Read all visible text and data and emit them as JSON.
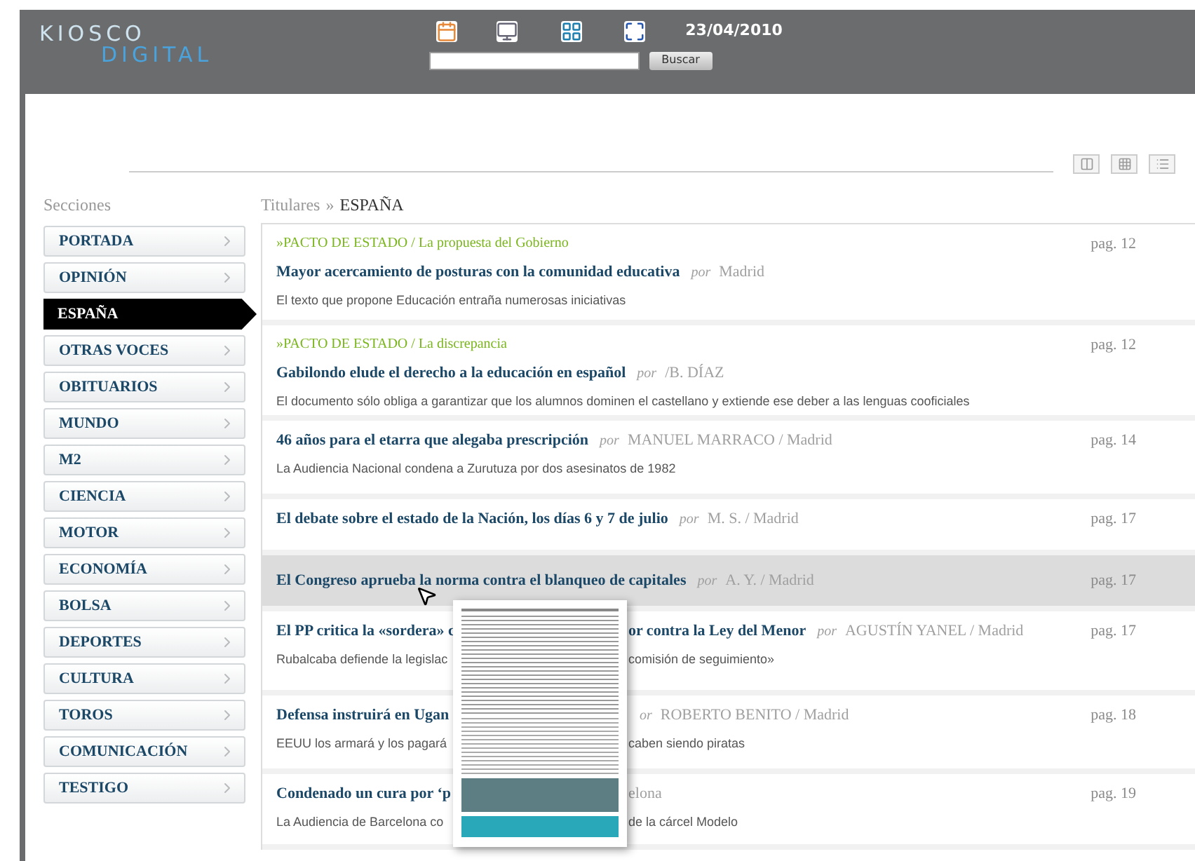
{
  "header": {
    "logo_top": "KIOSCO",
    "logo_bottom": "DIGITAL",
    "date": "23/04/2010",
    "search_button": "Buscar"
  },
  "sidebar": {
    "title": "Secciones",
    "items": [
      {
        "label": "PORTADA",
        "selected": false
      },
      {
        "label": "OPINIÓN",
        "selected": false
      },
      {
        "label": "ESPAÑA",
        "selected": true
      },
      {
        "label": "OTRAS VOCES",
        "selected": false
      },
      {
        "label": "OBITUARIOS",
        "selected": false
      },
      {
        "label": "MUNDO",
        "selected": false
      },
      {
        "label": "M2",
        "selected": false
      },
      {
        "label": "CIENCIA",
        "selected": false
      },
      {
        "label": "MOTOR",
        "selected": false
      },
      {
        "label": "ECONOMÍA",
        "selected": false
      },
      {
        "label": "BOLSA",
        "selected": false
      },
      {
        "label": "DEPORTES",
        "selected": false
      },
      {
        "label": "CULTURA",
        "selected": false
      },
      {
        "label": "TOROS",
        "selected": false
      },
      {
        "label": "COMUNICACIÓN",
        "selected": false
      },
      {
        "label": "TESTIGO",
        "selected": false
      }
    ]
  },
  "breadcrumb": {
    "label": "Titulares",
    "separator": "»",
    "current": "ESPAÑA"
  },
  "articles": [
    {
      "kicker": "»PACTO DE ESTADO / La propuesta del Gobierno",
      "title": "Mayor acercamiento de posturas con la comunidad educativa",
      "por": "por",
      "author": "Madrid",
      "summary": "El texto que propone Educación entraña numerosas iniciativas",
      "page": "pag. 12",
      "hovered": false
    },
    {
      "kicker": "»PACTO DE ESTADO / La discrepancia",
      "title": "Gabilondo elude el derecho a la educación en español",
      "por": "por",
      "author": "/B. DÍAZ",
      "summary": "El documento sólo obliga a garantizar que los alumnos dominen el castellano y extiende ese deber a las lenguas cooficiales",
      "page": "pag. 12",
      "hovered": false
    },
    {
      "title": "46 años para el etarra que alegaba prescripción",
      "por": "por",
      "author": "MANUEL MARRACO / Madrid",
      "summary": "La Audiencia Nacional condena a Zurutuza por dos asesinatos de 1982",
      "page": "pag. 14",
      "hovered": false
    },
    {
      "title": "El debate sobre el estado de la Nación, los días 6 y 7 de julio",
      "por": "por",
      "author": "M. S. / Madrid",
      "page": "pag. 17",
      "hovered": false
    },
    {
      "title": "El Congreso aprueba la norma contra el blanqueo de capitales",
      "por": "por",
      "author": "A. Y. / Madrid",
      "page": "pag. 17",
      "hovered": true
    },
    {
      "title": "El PP critica la «sordera» c",
      "title_tail": "or contra la Ley del Menor",
      "por": "por",
      "author": "AGUSTÍN YANEL / Madrid",
      "summary": "Rubalcaba defiende la legislac",
      "summary_tail": "comisión de seguimiento»",
      "page": "pag. 17",
      "hovered": false
    },
    {
      "title": "Defensa instruirá en Ugan",
      "por": "or",
      "author": "ROBERTO BENITO / Madrid",
      "summary": "EEUU los armará y los pagará",
      "summary_tail": "caben siendo piratas",
      "page": "pag. 18",
      "hovered": false
    },
    {
      "title": "Condenado un cura por ‘p",
      "author": "elona",
      "summary": "La Audiencia de Barcelona co",
      "summary_tail": "de la cárcel Modelo",
      "page": "pag. 19",
      "hovered": false
    }
  ]
}
